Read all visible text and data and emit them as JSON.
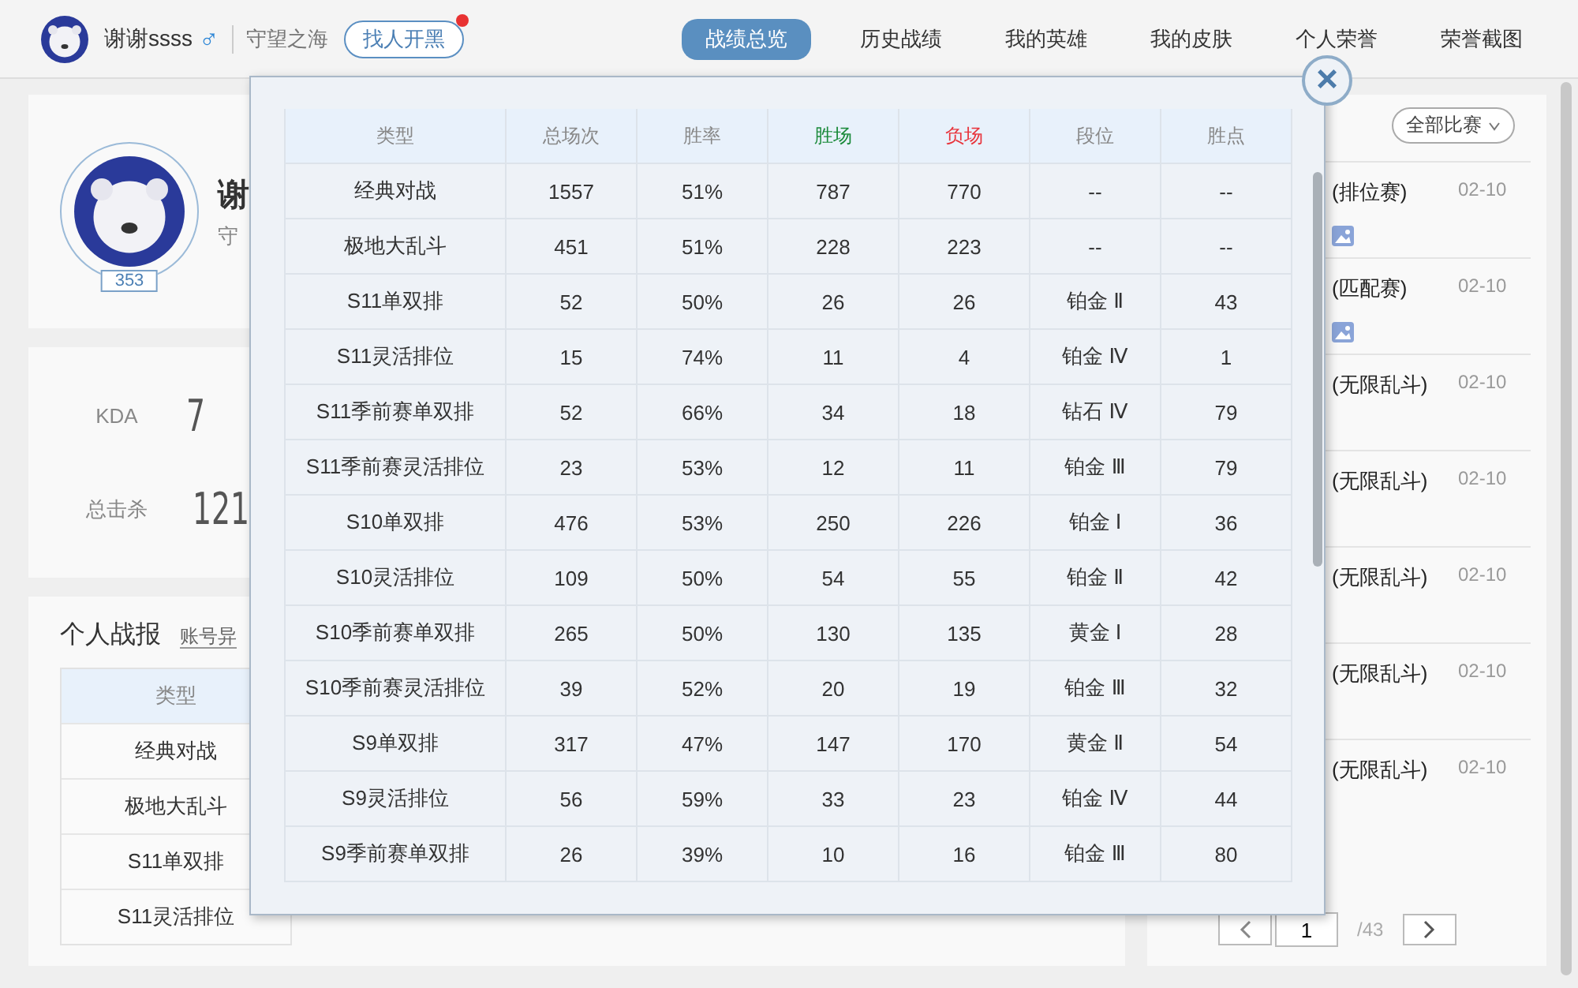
{
  "top_bar": {
    "player_name": "谢谢ssss",
    "gender_symbol": "♂",
    "server": "守望之海",
    "find_button": {
      "label": "找人开黑",
      "notify": true
    },
    "tabs": [
      {
        "label": "战绩总览",
        "selected": true
      },
      {
        "label": "历史战绩",
        "selected": false
      },
      {
        "label": "我的英雄",
        "selected": false
      },
      {
        "label": "我的皮肤",
        "selected": false
      },
      {
        "label": "个人荣誉",
        "selected": false
      },
      {
        "label": "荣誉截图",
        "selected": false
      }
    ]
  },
  "profile": {
    "name": "谢",
    "subtitle": "守",
    "level": "353"
  },
  "stats": [
    {
      "label": "KDA",
      "value": "7"
    },
    {
      "label": "总击杀",
      "value": "121"
    }
  ],
  "report": {
    "title": "个人战报",
    "link": "账号异",
    "column": "类型",
    "rows": [
      "经典对战",
      "极地大乱斗",
      "S11单双排",
      "S11灵活排位"
    ]
  },
  "matches": {
    "filter": "全部比赛",
    "items": [
      {
        "mode": "(排位赛)",
        "date": "02-10",
        "media": true
      },
      {
        "mode": "(匹配赛)",
        "date": "02-10",
        "media": true
      },
      {
        "mode": "(无限乱斗)",
        "date": "02-10",
        "media": false
      },
      {
        "mode": "(无限乱斗)",
        "date": "02-10",
        "media": false
      },
      {
        "mode": "(无限乱斗)",
        "date": "02-10",
        "media": false
      },
      {
        "mode": "(无限乱斗)",
        "date": "02-10",
        "media": false
      },
      {
        "mode": "(无限乱斗)",
        "date": "02-10",
        "media": false
      }
    ],
    "page": "1",
    "total": "/43"
  },
  "modal": {
    "close": "×",
    "columns": [
      {
        "label": "类型"
      },
      {
        "label": "总场次"
      },
      {
        "label": "胜率"
      },
      {
        "label": "胜场",
        "color": "#1a8a3a"
      },
      {
        "label": "负场",
        "color": "#e8343c"
      },
      {
        "label": "段位"
      },
      {
        "label": "胜点"
      }
    ],
    "rows": [
      [
        "经典对战",
        "1557",
        "51%",
        "787",
        "770",
        "--",
        "--"
      ],
      [
        "极地大乱斗",
        "451",
        "51%",
        "228",
        "223",
        "--",
        "--"
      ],
      [
        "S11单双排",
        "52",
        "50%",
        "26",
        "26",
        "铂金 Ⅱ",
        "43"
      ],
      [
        "S11灵活排位",
        "15",
        "74%",
        "11",
        "4",
        "铂金 Ⅳ",
        "1"
      ],
      [
        "S11季前赛单双排",
        "52",
        "66%",
        "34",
        "18",
        "钻石 Ⅳ",
        "79"
      ],
      [
        "S11季前赛灵活排位",
        "23",
        "53%",
        "12",
        "11",
        "铂金 Ⅲ",
        "79"
      ],
      [
        "S10单双排",
        "476",
        "53%",
        "250",
        "226",
        "铂金 Ⅰ",
        "36"
      ],
      [
        "S10灵活排位",
        "109",
        "50%",
        "54",
        "55",
        "铂金 Ⅱ",
        "42"
      ],
      [
        "S10季前赛单双排",
        "265",
        "50%",
        "130",
        "135",
        "黄金 Ⅰ",
        "28"
      ],
      [
        "S10季前赛灵活排位",
        "39",
        "52%",
        "20",
        "19",
        "铂金 Ⅲ",
        "32"
      ],
      [
        "S9单双排",
        "317",
        "47%",
        "147",
        "170",
        "黄金 Ⅱ",
        "54"
      ],
      [
        "S9灵活排位",
        "56",
        "59%",
        "33",
        "23",
        "铂金 Ⅳ",
        "44"
      ],
      [
        "S9季前赛单双排",
        "26",
        "39%",
        "10",
        "16",
        "铂金 Ⅲ",
        "80"
      ]
    ]
  }
}
